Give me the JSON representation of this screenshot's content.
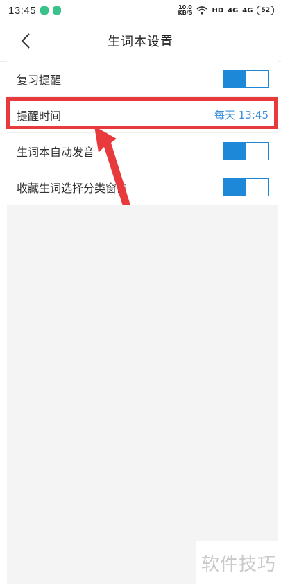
{
  "status_bar": {
    "time": "13:45",
    "net_speed_value": "10.0",
    "net_speed_unit": "KB/S",
    "hd_label": "HD",
    "signal1": "4G",
    "signal2": "4G",
    "battery": "52"
  },
  "header": {
    "title": "生词本设置"
  },
  "settings": [
    {
      "label": "复习提醒",
      "toggle_on": true
    },
    {
      "label": "提醒时间",
      "value": "每天 13:45"
    },
    {
      "label": "生词本自动发音",
      "toggle_on": true
    },
    {
      "label": "收藏生词选择分类窗口",
      "toggle_on": true
    }
  ],
  "watermark": "软件技巧",
  "colors": {
    "accent": "#1d87d8",
    "highlight": "#e83a3c",
    "time_value": "#3c90d8"
  }
}
